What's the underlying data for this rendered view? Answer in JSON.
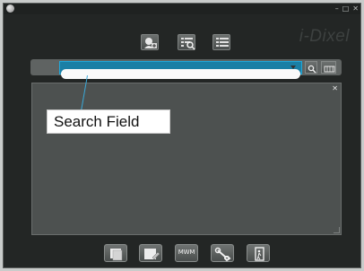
{
  "window": {
    "controls": {
      "minimize": "–",
      "maximize": "□",
      "close": "✕"
    }
  },
  "logo": {
    "text": "i-Dixel"
  },
  "top_toolbar": {
    "buttons": [
      {
        "icon": "add-user-icon"
      },
      {
        "icon": "list-search-icon"
      },
      {
        "icon": "list-icon"
      }
    ]
  },
  "search": {
    "value": "",
    "has_dropdown": true
  },
  "panel": {
    "close_label": "✕"
  },
  "callout": {
    "label": "Search Field"
  },
  "bottom_toolbar": {
    "buttons": [
      {
        "icon": "image-icon"
      },
      {
        "icon": "image-edit-icon"
      },
      {
        "icon": "mwm-icon",
        "label": "MWM"
      },
      {
        "icon": "wrench-icon"
      },
      {
        "icon": "exit-door-icon"
      }
    ]
  },
  "colors": {
    "background": "#232625",
    "panel": "#4d5150",
    "accent": "#21a7d8",
    "callout_bg": "#ffffff"
  }
}
